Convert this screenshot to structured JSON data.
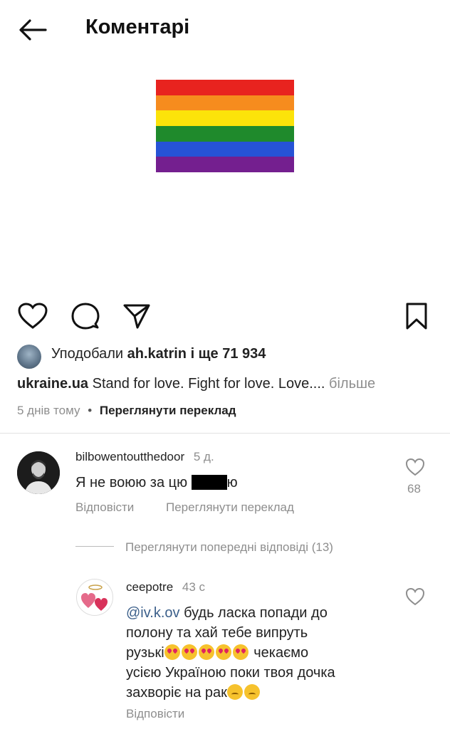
{
  "header": {
    "title": "Коментарі"
  },
  "post": {
    "flag_colors": [
      "#e8231f",
      "#f68c1e",
      "#fce30a",
      "#1f8a2c",
      "#2653d6",
      "#741f8f"
    ],
    "likes": {
      "prefix": "Уподобали",
      "user": "ah.katrin",
      "suffix": "і ще 71 934"
    },
    "caption": {
      "user": "ukraine.ua",
      "text": "Stand for love. Fight for love. Love....",
      "more": "більше"
    },
    "time": "5 днів тому",
    "bullet": "•",
    "translate": "Переглянути переклад"
  },
  "comments": [
    {
      "user": "bilbowentoutthedoor",
      "time": "5 д.",
      "text_before": "Я не воюю за цю",
      "text_after": "ю",
      "likes": "68",
      "reply": "Відповісти",
      "translate": "Переглянути переклад"
    }
  ],
  "replies_toggle": "Переглянути попередні відповіді (13)",
  "reply_comment": {
    "user": "ceepotre",
    "time": "43 с",
    "mention": "@iv.k.ov",
    "line1": "будь ласка попади до",
    "line2": "полону та хай тебе випруть",
    "line3_start": "рузькі",
    "line3_end": "чекаємо",
    "line4": "усією Україною поки твоя дочка",
    "line5": "захворіє на рак",
    "reply": "Відповісти"
  }
}
